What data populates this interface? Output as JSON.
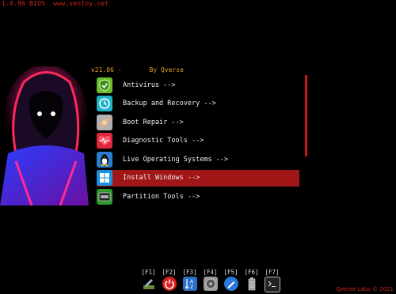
{
  "topline": {
    "version": "1.0.96 BIOS",
    "url": "www.ventoy.net"
  },
  "header": {
    "version": "v21.06 -",
    "by": "By Qverse"
  },
  "menu": {
    "items": [
      {
        "label": "Antivirus -->",
        "icon": "antivirus-shield-icon",
        "color": "#6bbf2a"
      },
      {
        "label": "Backup and Recovery -->",
        "icon": "backup-clock-icon",
        "color": "#1fb3c8"
      },
      {
        "label": "Boot Repair -->",
        "icon": "bandage-icon",
        "color": "#b0b0b0"
      },
      {
        "label": "Diagnostic Tools -->",
        "icon": "heartbeat-icon",
        "color": "#e0283c"
      },
      {
        "label": "Live Operating Systems -->",
        "icon": "linux-penguin-icon",
        "color": "#2a7fd0"
      },
      {
        "label": "Install Windows -->",
        "icon": "windows-logo-icon",
        "color": "#1a90e0"
      },
      {
        "label": "Partition Tools -->",
        "icon": "ssd-drive-icon",
        "color": "#2e9a2e"
      }
    ],
    "selected_index": 5
  },
  "fkeys": [
    {
      "key": "[F1]",
      "icon": "tools-icon"
    },
    {
      "key": "[F2]",
      "icon": "power-icon"
    },
    {
      "key": "[F3]",
      "icon": "sort-az-icon"
    },
    {
      "key": "[F4]",
      "icon": "disk-drive-icon"
    },
    {
      "key": "[F5]",
      "icon": "pen-icon"
    },
    {
      "key": "[F6]",
      "icon": "battery-icon"
    },
    {
      "key": "[F7]",
      "icon": "terminal-icon"
    }
  ],
  "copyright": "Qverse Labs © 2021",
  "colors": {
    "accent": "#d01818",
    "selection": "#a11616",
    "header": "#e0a020"
  }
}
